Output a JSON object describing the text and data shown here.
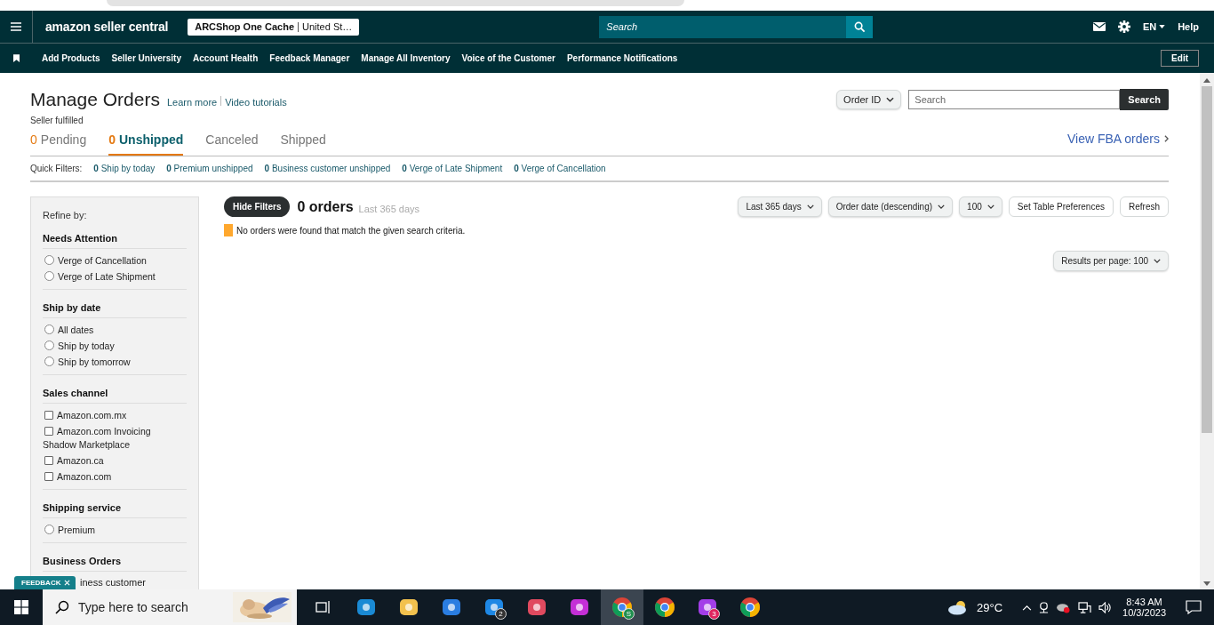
{
  "header": {
    "logo": "amazon seller central",
    "store": "ARCShop One Cache",
    "store_region": "United St…",
    "search_placeholder": "Search",
    "language": "EN",
    "help": "Help"
  },
  "nav": {
    "links": [
      "Add Products",
      "Seller University",
      "Account Health",
      "Feedback Manager",
      "Manage All Inventory",
      "Voice of the Customer",
      "Performance Notifications"
    ],
    "edit": "Edit"
  },
  "page": {
    "title": "Manage Orders",
    "links": [
      "Learn more",
      "Video tutorials"
    ],
    "subtitle": "Seller fulfilled",
    "search_type": "Order ID",
    "search_placeholder": "Search",
    "search_button": "Search"
  },
  "tabs": [
    {
      "count": "0",
      "label": "Pending",
      "selected": false
    },
    {
      "count": "0",
      "label": "Unshipped",
      "selected": true
    },
    {
      "label": "Canceled",
      "selected": false
    },
    {
      "label": "Shipped",
      "selected": false
    }
  ],
  "fba_link": "View FBA orders",
  "quick_filters": {
    "label": "Quick Filters:",
    "items": [
      {
        "count": "0",
        "label": "Ship by today"
      },
      {
        "count": "0",
        "label": "Premium unshipped"
      },
      {
        "count": "0",
        "label": "Business customer unshipped"
      },
      {
        "count": "0",
        "label": "Verge of Late Shipment"
      },
      {
        "count": "0",
        "label": "Verge of Cancellation"
      }
    ]
  },
  "sidebar": {
    "title": "Refine by:",
    "sections": [
      {
        "title": "Needs Attention",
        "options": [
          {
            "kind": "radio",
            "label": "Verge of Cancellation",
            "checked": false
          },
          {
            "kind": "radio",
            "label": "Verge of Late Shipment",
            "checked": false
          }
        ]
      },
      {
        "title": "Ship by date",
        "options": [
          {
            "kind": "radio",
            "label": "All dates",
            "checked": false
          },
          {
            "kind": "radio",
            "label": "Ship by today",
            "checked": false
          },
          {
            "kind": "radio",
            "label": "Ship by tomorrow",
            "checked": false
          }
        ]
      },
      {
        "title": "Sales channel",
        "options": [
          {
            "kind": "checkbox",
            "label": "Amazon.com.mx",
            "checked": false
          },
          {
            "kind": "checkbox",
            "label": "Amazon.com Invoicing Shadow Marketplace",
            "checked": false
          },
          {
            "kind": "checkbox",
            "label": "Amazon.ca",
            "checked": false
          },
          {
            "kind": "checkbox",
            "label": "Amazon.com",
            "checked": false
          }
        ]
      },
      {
        "title": "Shipping service",
        "options": [
          {
            "kind": "radio",
            "label": "Premium",
            "checked": false
          }
        ]
      },
      {
        "title": "Business Orders",
        "options": [
          {
            "kind": "partial",
            "label": "iness customer"
          }
        ]
      }
    ]
  },
  "results": {
    "hide_filters": "Hide Filters",
    "count": "0 orders",
    "range": "Last 365 days",
    "message": "No orders were found that match the given search criteria.",
    "per_page": "Results per page: 100",
    "controls": [
      {
        "kind": "dropdown",
        "label": "Last 365 days"
      },
      {
        "kind": "dropdown",
        "label": "Order date (descending)"
      },
      {
        "kind": "dropdown",
        "label": "100"
      },
      {
        "kind": "button",
        "label": "Set Table Preferences"
      },
      {
        "kind": "button",
        "label": "Refresh"
      }
    ]
  },
  "feedback": "FEEDBACK",
  "taskbar": {
    "search_placeholder": "Type here to search",
    "apps": [
      {
        "kind": "taskview",
        "selected": false
      },
      {
        "kind": "edge",
        "selected": false
      },
      {
        "kind": "folder",
        "selected": false
      },
      {
        "kind": "store",
        "selected": false
      },
      {
        "kind": "mail",
        "badge": "2",
        "selected": false
      },
      {
        "kind": "snip",
        "selected": false
      },
      {
        "kind": "wps",
        "selected": false
      },
      {
        "kind": "chrome",
        "badge": "S",
        "selected": true
      },
      {
        "kind": "chrome",
        "selected": false
      },
      {
        "kind": "messenger",
        "badge": "3",
        "selected": false
      },
      {
        "kind": "chrome",
        "selected": false
      }
    ],
    "temperature": "29°C",
    "time": "8:43 AM",
    "date": "10/3/2023"
  }
}
